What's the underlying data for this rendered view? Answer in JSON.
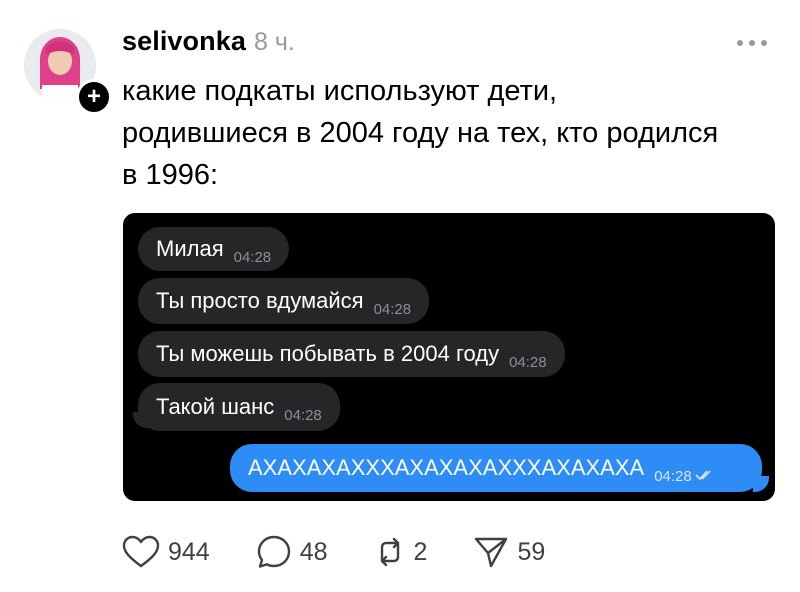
{
  "post": {
    "username": "selivonka",
    "time": "8 ч.",
    "text_lines": [
      "какие подкаты используют дети,",
      "родившиеся в 2004 году на тех, кто родился",
      "в 1996:"
    ]
  },
  "chat": {
    "messages": [
      {
        "text": "Милая",
        "time": "04:28",
        "direction": "incoming"
      },
      {
        "text": "Ты просто вдумайся",
        "time": "04:28",
        "direction": "incoming"
      },
      {
        "text": "Ты можешь побывать в 2004 году",
        "time": "04:28",
        "direction": "incoming"
      },
      {
        "text": "Такой шанс",
        "time": "04:28",
        "direction": "incoming"
      },
      {
        "text": "АХАХАХАХХХАХАХАХАХХХАХАХАХА",
        "time": "04:28",
        "direction": "outgoing",
        "status_icon": "double-check-icon"
      }
    ]
  },
  "actions": {
    "likes": "944",
    "comments": "48",
    "reposts": "2",
    "shares": "59"
  },
  "colors": {
    "accent_blue": "#2d8cf5",
    "incoming_bubble": "#262629",
    "muted_text": "#9a9a9a"
  }
}
